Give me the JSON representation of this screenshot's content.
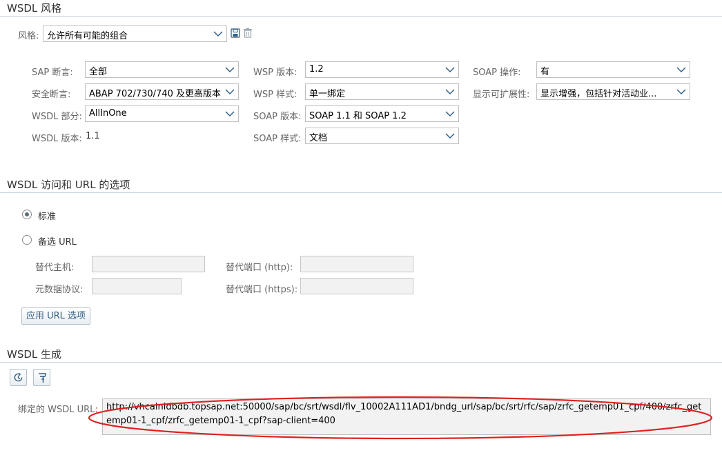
{
  "style_section": {
    "title": "WSDL 风格",
    "style_label": "风格:",
    "style_value": "允许所有可能的组合",
    "save_icon": "save-icon",
    "delete_icon": "trash-icon"
  },
  "settings": {
    "sap_assertion": {
      "label": "SAP 断言:",
      "value": "全部"
    },
    "security_assertion": {
      "label": "安全断言:",
      "value": "ABAP 702/730/740 及更高版本"
    },
    "wsdl_part": {
      "label": "WSDL 部分:",
      "value": "AllInOne"
    },
    "wsdl_version": {
      "label": "WSDL 版本:",
      "value": "1.1"
    },
    "wsp_version": {
      "label": "WSP 版本:",
      "value": "1.2"
    },
    "wsp_style": {
      "label": "WSP 样式:",
      "value": "单一绑定"
    },
    "soap_version": {
      "label": "SOAP 版本:",
      "value": "SOAP 1.1 和 SOAP 1.2"
    },
    "soap_style": {
      "label": "SOAP 样式:",
      "value": "文档"
    },
    "soap_operation": {
      "label": "SOAP 操作:",
      "value": "有"
    },
    "show_extensibility": {
      "label": "显示可扩展性:",
      "value": "显示增强，包括针对活动业..."
    }
  },
  "access_section": {
    "title": "WSDL 访问和 URL 的选项",
    "radio_standard": "标准",
    "radio_alt_url": "备选 URL",
    "selected": "standard",
    "alt_host_label": "替代主机:",
    "alt_port_http_label": "替代端口 (http):",
    "metadata_protocol_label": "元数据协议:",
    "alt_port_https_label": "替代端口 (https):",
    "apply_button": "应用 URL 选项"
  },
  "generation_section": {
    "title": "WSDL 生成",
    "bound_url_label": "绑定的 WSDL URL:",
    "bound_url_value": "http://vhcalnldbdb.topsap.net:50000/sap/bc/srt/wsdl/flv_10002A111AD1/bndg_url/sap/bc/srt/rfc/sap/zrfc_getemp01_cpf/400/zrfc_getemp01-1_cpf/zrfc_getemp01-1_cpf?sap-client=400",
    "icons": [
      "clock-refresh-icon",
      "wsdl-tool-icon"
    ],
    "annotation_color": "#e02020"
  },
  "colors": {
    "accent": "#346187",
    "section_line": "#c8d3dc",
    "field_bg": "#f2f2f2"
  }
}
